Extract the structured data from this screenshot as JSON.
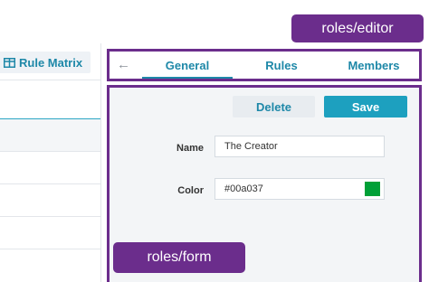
{
  "annotations": {
    "editor_label": "roles/editor",
    "form_label": "roles/form"
  },
  "left_panel": {
    "rule_matrix_label": "Rule Matrix",
    "rule_matrix_icon": "table-grid-icon"
  },
  "editor": {
    "back_icon": "arrow-left-icon",
    "tabs": [
      {
        "label": "General",
        "active": true
      },
      {
        "label": "Rules",
        "active": false
      },
      {
        "label": "Members",
        "active": false
      }
    ]
  },
  "form": {
    "delete_label": "Delete",
    "save_label": "Save",
    "name_label": "Name",
    "name_value": "The Creator",
    "color_label": "Color",
    "color_value": "#00a037"
  },
  "colors": {
    "accent": "#1e88a8",
    "annotation": "#6b2d8c",
    "swatch": "#00a037"
  }
}
